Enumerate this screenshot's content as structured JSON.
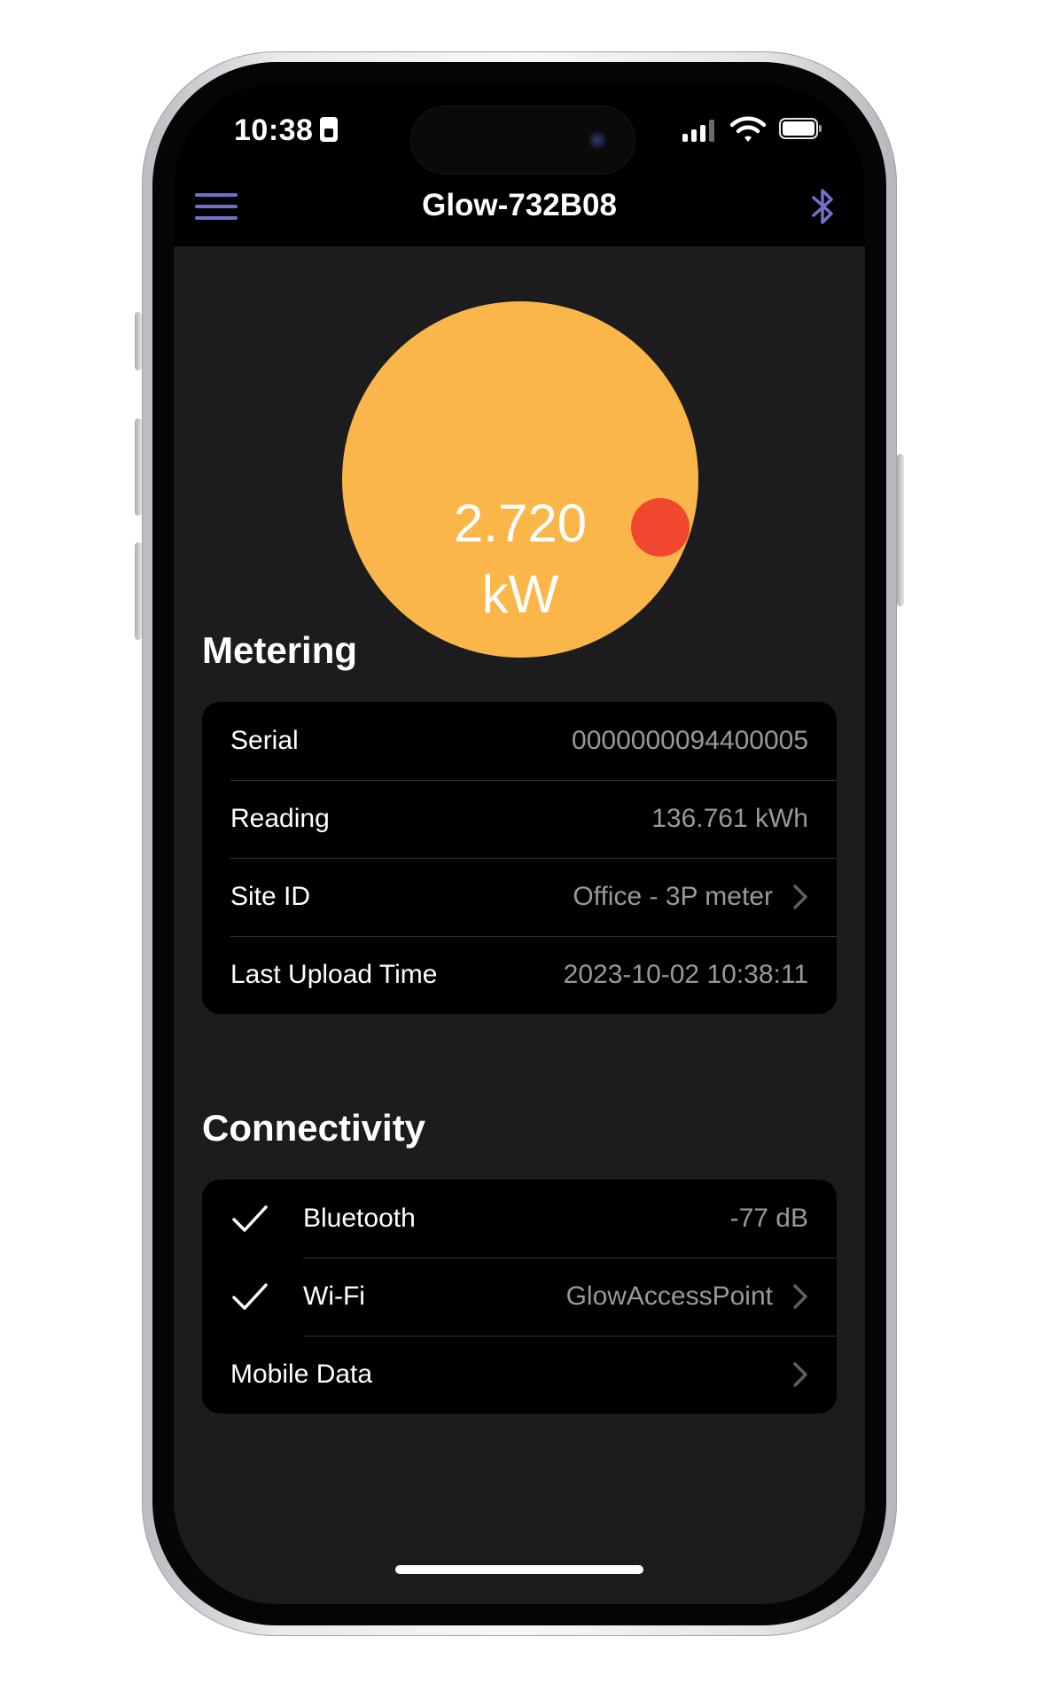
{
  "status_bar": {
    "time": "10:38",
    "icons": [
      "sim-card-icon",
      "cellular-signal-icon",
      "wifi-icon",
      "battery-icon"
    ]
  },
  "nav": {
    "title": "Glow-732B08",
    "left_icon": "menu-icon",
    "right_icon": "bluetooth-icon",
    "accent_color": "#6e72c8"
  },
  "gauge": {
    "value": "2.720",
    "unit": "kW",
    "color": "#fbb649",
    "indicator_color": "#f0472e"
  },
  "metering": {
    "title": "Metering",
    "rows": [
      {
        "label": "Serial",
        "value": "0000000094400005"
      },
      {
        "label": "Reading",
        "value": "136.761 kWh"
      },
      {
        "label": "Site ID",
        "value": "Office - 3P meter"
      },
      {
        "label": "Last Upload Time",
        "value": "2023-10-02 10:38:11"
      }
    ]
  },
  "connectivity": {
    "title": "Connectivity",
    "rows": [
      {
        "label": "Bluetooth",
        "value": "-77 dB"
      },
      {
        "label": "Wi-Fi",
        "value": "GlowAccessPoint"
      },
      {
        "label": "Mobile Data",
        "value": ""
      }
    ]
  }
}
